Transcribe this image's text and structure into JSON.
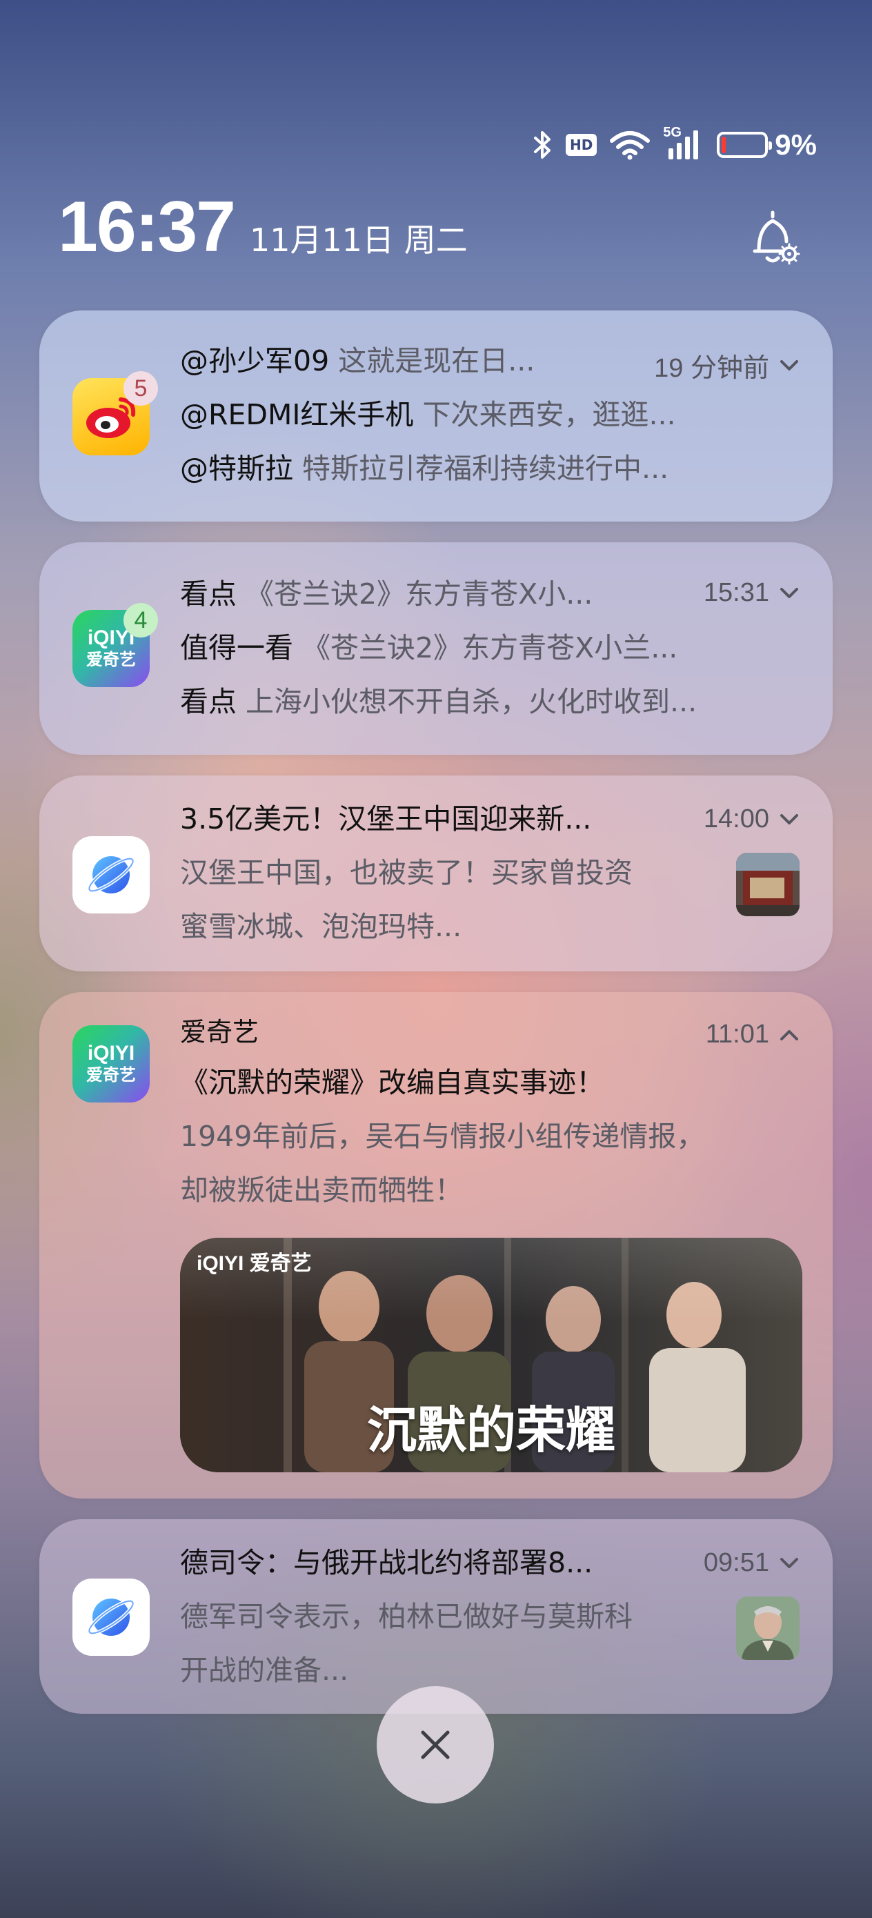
{
  "status_bar": {
    "bluetooth_icon": "bluetooth-icon",
    "hd_label": "HD",
    "wifi_icon": "wifi-icon",
    "signal_label": "5G",
    "battery_level": 0.09,
    "battery_text": "9%",
    "battery_color": "#ff3b30"
  },
  "lock": {
    "time": "16:37",
    "date": "11月11日 周二",
    "bell_icon": "notification-settings-icon"
  },
  "notifications": [
    {
      "app": "weibo",
      "badge": "5",
      "time": "19 分钟前",
      "lines": [
        {
          "sender": "@孙少军09",
          "text": "这就是现在日..."
        },
        {
          "sender": "@REDMI红米手机",
          "text": "下次来西安，逛逛..."
        },
        {
          "sender": "@特斯拉",
          "text": "特斯拉引荐福利持续进行中..."
        }
      ]
    },
    {
      "app": "iqiyi",
      "badge": "4",
      "time": "15:31",
      "lines": [
        {
          "sender": "看点",
          "text": "《苍兰诀2》东方青苍X小..."
        },
        {
          "sender": "值得一看",
          "text": "《苍兰诀2》东方青苍X小兰..."
        },
        {
          "sender": "看点",
          "text": "上海小伙想不开自杀，火化时收到..."
        }
      ]
    },
    {
      "app": "browser",
      "time": "14:00",
      "title": "3.5亿美元！汉堡王中国迎来新...",
      "body_lines": [
        "汉堡王中国，也被卖了！买家曾投资",
        "蜜雪冰城、泡泡玛特..."
      ]
    },
    {
      "app": "iqiyi",
      "app_name": "爱奇艺",
      "time": "11:01",
      "title": "《沉默的荣耀》改编自真实事迹！",
      "body_lines": [
        "1949年前后，吴石与情报小组传递情报，",
        "却被叛徒出卖而牺牲！"
      ],
      "banner_brand": "iQIYI 爱奇艺",
      "banner_title": "沉默的荣耀"
    },
    {
      "app": "browser",
      "time": "09:51",
      "title": "德司令：与俄开战北约将部署8...",
      "body_lines": [
        "德军司令表示，柏林已做好与莫斯科",
        "开战的准备..."
      ]
    }
  ],
  "icons": {
    "iqiyi_logo_text": "iQIYI",
    "iqiyi_logo_sub": "爱奇艺"
  },
  "close_icon": "close-icon"
}
